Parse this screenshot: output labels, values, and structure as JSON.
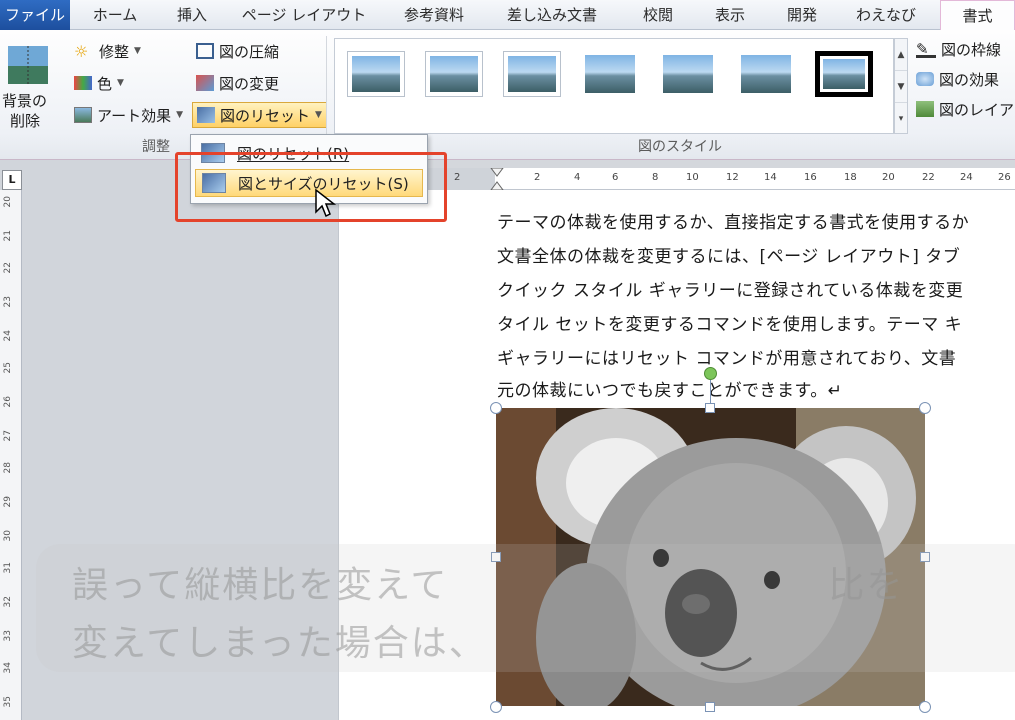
{
  "tabs": [
    "ファイル",
    "ホーム",
    "挿入",
    "ページ レイアウト",
    "参考資料",
    "差し込み文書",
    "校閲",
    "表示",
    "開発",
    "わえなび",
    "書式"
  ],
  "ribbon": {
    "remove_bg": [
      "背景の",
      "削除"
    ],
    "corrections": "修整",
    "color": "色",
    "artistic": "アート効果",
    "compress": "図の圧縮",
    "change": "図の変更",
    "reset": "図のリセット",
    "adjust_group": "調整",
    "styles_group": "図のスタイル",
    "border": "図の枠線",
    "effects": "図の効果",
    "layout": "図のレイア"
  },
  "menu": {
    "item1": "図のリセット(R)",
    "item2": "図とサイズのリセット(S)"
  },
  "ruler": {
    "h": [
      "2",
      "2",
      "4",
      "6",
      "8",
      "10",
      "12",
      "14",
      "16",
      "18",
      "20",
      "22",
      "24",
      "26"
    ],
    "v": [
      "20",
      "21",
      "22",
      "23",
      "24",
      "25",
      "26",
      "27",
      "28",
      "29",
      "30",
      "31",
      "32",
      "33",
      "34",
      "35"
    ]
  },
  "document": {
    "lines": [
      "テーマの体裁を使用するか、直接指定する書式を使用するか",
      "文書全体の体裁を変更するには、[ページ レイアウト] タブ",
      "クイック スタイル ギャラリーに登録されている体裁を変更",
      "タイル セットを変更するコマンドを使用します。テーマ キ",
      "ギャラリーにはリセット コマンドが用意されており、文書",
      "元の体裁にいつでも戻すことができます。↵"
    ]
  },
  "caption": {
    "line1": "誤って縦横比を変えて　　　　　　　　　　比を",
    "line2": "変えてしまった場合は、"
  }
}
